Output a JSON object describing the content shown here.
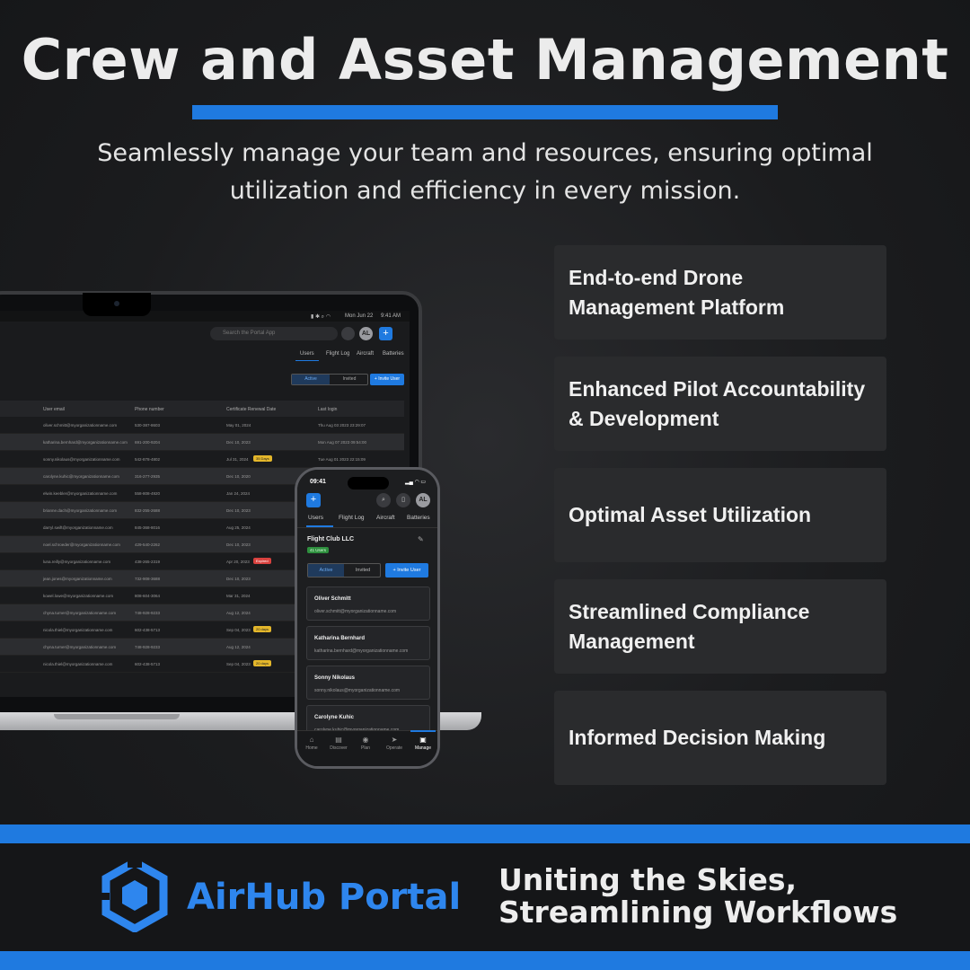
{
  "header": {
    "title": "Crew and Asset Management",
    "subtitle": "Seamlessly manage your team and resources, ensuring optimal utilization and efficiency in every mission."
  },
  "features": [
    "End-to-end Drone Management Platform",
    "Enhanced Pilot Accountability & Development",
    "Optimal Asset Utilization",
    "Streamlined Compliance Management",
    "Informed Decision Making"
  ],
  "laptop": {
    "menubar_date": "Mon Jun 22",
    "menubar_time": "9:41 AM",
    "search_placeholder": "Search the Portal App",
    "avatar_initials": "AL",
    "plus": "+",
    "tabs": [
      "Users",
      "Flight Log",
      "Aircraft",
      "Batteries"
    ],
    "toggle_active": "Active",
    "toggle_invited": "Invited",
    "invite_button": "+ Invite User",
    "columns": [
      "User email",
      "Phone number",
      "Certificate Renewal Date",
      "Last login"
    ],
    "rows": [
      {
        "email": "oliver.schmitt@myorganizationname.com",
        "phone": "530-387-8603",
        "renewal": "May 01, 2024",
        "badge": "",
        "last": "Thu Aug 03 2023 23:29:07"
      },
      {
        "email": "katharina.bernhard@myorganizationname.com",
        "phone": "691-200-9204",
        "renewal": "Dec 10, 2023",
        "badge": "",
        "last": "Mon Aug 07 2023 09:54:00"
      },
      {
        "email": "sonny.nikolaus@myorganizationname.com",
        "phone": "542-878-4802",
        "renewal": "Jul 31, 2024",
        "badge": "35 Days",
        "last": "Tue Aug 01 2023 22:15:09"
      },
      {
        "email": "carolyne.kuhic@myorganizationname.com",
        "phone": "316-277-2935",
        "renewal": "Dec 10, 2020",
        "badge": "",
        "last": ""
      },
      {
        "email": "elwin.keebler@myorganizationname.com",
        "phone": "558-808-4920",
        "renewal": "Jan 24, 2024",
        "badge": "",
        "last": ""
      },
      {
        "email": "brianne.dach@myorganizationname.com",
        "phone": "832-255-2688",
        "renewal": "Dec 10, 2023",
        "badge": "",
        "last": ""
      },
      {
        "email": "darryl.swift@myorganizationname.com",
        "phone": "845-368-8016",
        "renewal": "Aug 25, 2024",
        "badge": "",
        "last": ""
      },
      {
        "email": "noel.schroeder@myorganizationname.com",
        "phone": "429-540-2262",
        "renewal": "Dec 10, 2023",
        "badge": "",
        "last": ""
      },
      {
        "email": "luna.reilly@myorganizationname.com",
        "phone": "438-265-2319",
        "renewal": "Apr 20, 2023",
        "badge": "Expired",
        "last": ""
      },
      {
        "email": "jean.jones@myorganizationname.com",
        "phone": "732-908-3688",
        "renewal": "Dec 10, 2023",
        "badge": "",
        "last": ""
      },
      {
        "email": "kowel.lowe@myorganizationname.com",
        "phone": "808-604-3064",
        "renewal": "Mar 31, 2024",
        "badge": "",
        "last": ""
      },
      {
        "email": "chyna.turner@myorganizationname.com",
        "phone": "748-928-9233",
        "renewal": "Aug 12, 2024",
        "badge": "",
        "last": ""
      },
      {
        "email": "nicola.thiel@myorganizationname.com",
        "phone": "602-438-5713",
        "renewal": "Sep 04, 2023",
        "badge": "20 days",
        "last": ""
      },
      {
        "email": "chyna.turner@myorganizationname.com",
        "phone": "748-928-9233",
        "renewal": "Aug 12, 2024",
        "badge": "",
        "last": ""
      },
      {
        "email": "nicola.thiel@myorganizationname.com",
        "phone": "602-438-5713",
        "renewal": "Sep 04, 2023",
        "badge": "20 days",
        "last": ""
      }
    ]
  },
  "phone": {
    "time": "09:41",
    "avatar_initials": "AL",
    "plus": "+",
    "tabs": [
      "Users",
      "Flight Log",
      "Aircraft",
      "Batteries"
    ],
    "org_name": "Flight Club LLC",
    "users_count": "41 Users",
    "toggle_active": "Active",
    "toggle_invited": "Invited",
    "invite_button": "+ Invite User",
    "users": [
      {
        "name": "Oliver Schmitt",
        "email": "oliver.schmitt@myorganizationname.com"
      },
      {
        "name": "Katharina Bernhard",
        "email": "katharina.bernhard@myorganizationname.com"
      },
      {
        "name": "Sonny Nikolaus",
        "email": "sonny.nikolaus@myorganizationname.com"
      },
      {
        "name": "Carolyne Kuhic",
        "email": "carolyne.kuhic@myorganizationname.com"
      }
    ],
    "nav": [
      "Home",
      "Discover",
      "Plan",
      "Operate",
      "Manage"
    ]
  },
  "footer": {
    "brand": "AirHub Portal",
    "tagline_line1": "Uniting the Skies,",
    "tagline_line2": "Streamlining Workflows"
  },
  "colors": {
    "accent": "#1f7ae0",
    "background": "#1b1c1e",
    "card": "#2a2b2d",
    "brand_blue": "#2e86ee"
  }
}
